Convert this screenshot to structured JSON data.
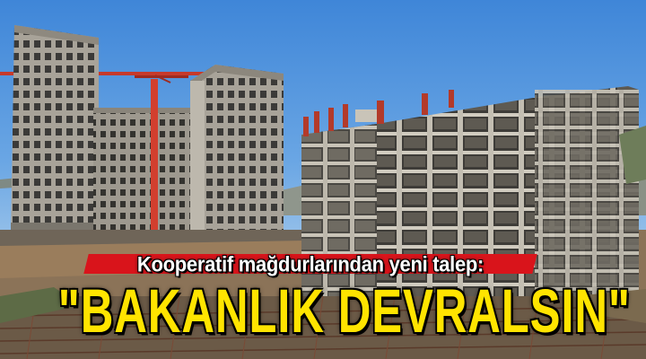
{
  "image": {
    "subheadline": "Kooperatif mağdurlarından yeni talep:",
    "headline": "\"BAKANLIK DEVRALSIN\"",
    "colors": {
      "sky": "#4f94dc",
      "concrete": "#a9a49b",
      "crane": "#d63a2a",
      "rebar": "#b33a2a",
      "banner_red": "#d9141b",
      "headline_yellow": "#ffe400"
    }
  }
}
